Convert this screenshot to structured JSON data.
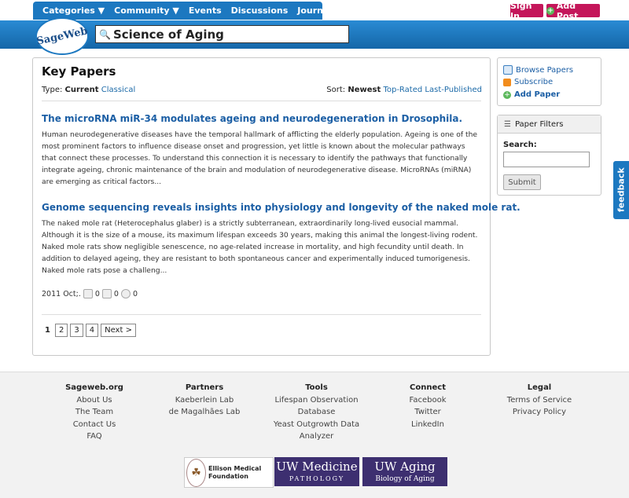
{
  "nav": {
    "items": [
      "Categories ▼",
      "Community ▼",
      "Events",
      "Discussions",
      "Journal Club"
    ],
    "sign_in": "Sign In",
    "add_post": "Add Post"
  },
  "header": {
    "logo_text": "SageWeb",
    "search_value": "Science of Aging"
  },
  "main": {
    "title": "Key Papers",
    "type_label": "Type:",
    "type_current": "Current",
    "type_classical": "Classical",
    "sort_label": "Sort:",
    "sort_newest": "Newest",
    "sort_top": "Top-Rated",
    "sort_last": "Last-Published",
    "articles": [
      {
        "title": "The microRNA miR-34 modulates ageing and neurodegeneration in Drosophila.",
        "body": "Human neurodegenerative diseases have the temporal hallmark of afflicting the elderly population. Ageing is one of the most prominent factors to influence disease onset and progression, yet little is known about the molecular pathways that connect these processes. To understand this connection it is necessary to identify the pathways that functionally integrate ageing, chronic maintenance of the brain and modulation of neurodegenerative disease. MicroRNAs (miRNA) are emerging as critical factors..."
      },
      {
        "title": "Genome sequencing reveals insights into physiology and longevity of the naked mole rat.",
        "body": "The naked mole rat (Heterocephalus glaber) is a strictly subterranean, extraordinarily long-lived eusocial mammal. Although it is the size of a mouse, its maximum lifespan exceeds 30 years, making this animal the longest-living rodent. Naked mole rats show negligible senescence, no age-related increase in mortality, and high fecundity until death. In addition to delayed ageing, they are resistant to both spontaneous cancer and experimentally induced tumorigenesis. Naked mole rats pose a challeng..."
      }
    ],
    "meta": {
      "date": "2011 Oct;.",
      "likes": "0",
      "saves": "0",
      "comments": "0"
    },
    "pager": {
      "pages": [
        "1",
        "2",
        "3",
        "4"
      ],
      "next": "Next >"
    }
  },
  "side": {
    "browse": "Browse Papers",
    "subscribe": "Subscribe",
    "add_paper": "Add Paper",
    "filters_title": "Paper Filters",
    "search_label": "Search:",
    "submit": "Submit"
  },
  "feedback": "feedback",
  "footer": {
    "cols": [
      {
        "head": "Sageweb.org",
        "items": [
          "About Us",
          "The Team",
          "Contact Us",
          "FAQ"
        ]
      },
      {
        "head": "Partners",
        "items": [
          "Kaeberlein Lab",
          "de Magalhães Lab"
        ]
      },
      {
        "head": "Tools",
        "items": [
          "Lifespan Observation",
          "Database",
          "Yeast Outgrowth Data",
          "Analyzer"
        ]
      },
      {
        "head": "Connect",
        "items": [
          "Facebook",
          "Twitter",
          "LinkedIn"
        ]
      },
      {
        "head": "Legal",
        "items": [
          "Terms of Service",
          "Privacy Policy"
        ]
      }
    ],
    "logo1": "Ellison Medical Foundation",
    "logo2_a": "UW Medicine",
    "logo2_b": "PATHOLOGY",
    "logo3_a": "UW Aging",
    "logo3_b": "Biology of Aging"
  },
  "colors": {
    "brand_blue": "#1c78c0",
    "accent_pink": "#c4165a",
    "link": "#1c5fa5"
  },
  "icons": [
    "search-icon",
    "browse-icon",
    "rss-icon",
    "add-icon",
    "filter-icon",
    "like-icon",
    "save-icon",
    "comment-icon"
  ]
}
